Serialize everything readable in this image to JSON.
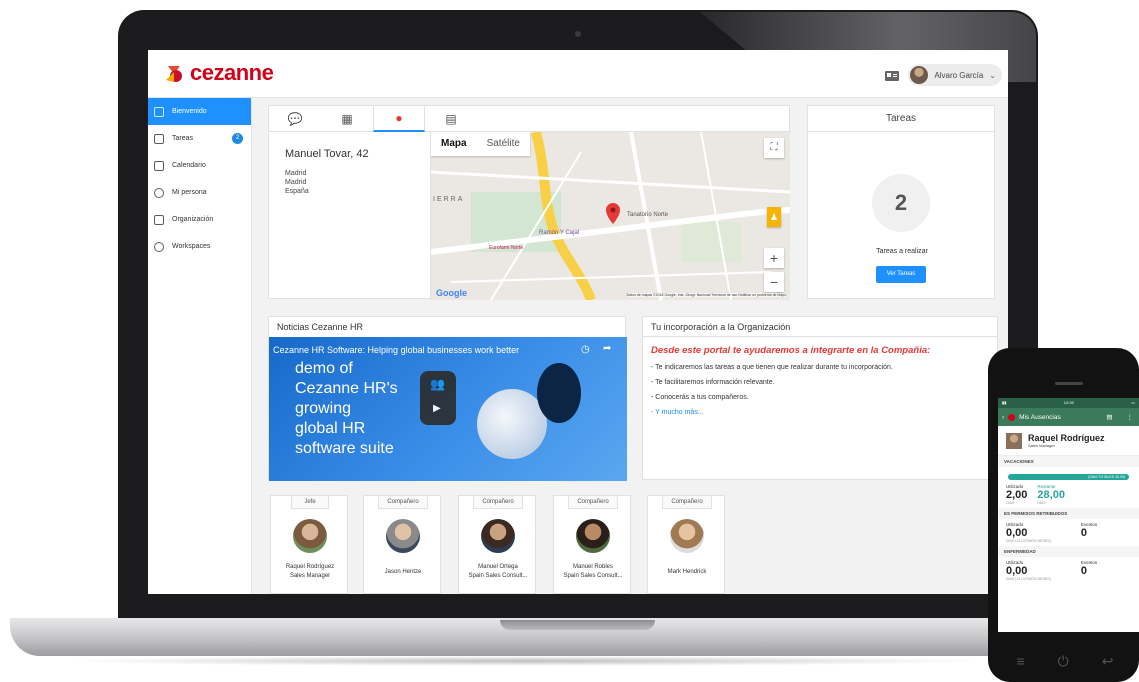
{
  "brand": {
    "logo_text": "cezanne",
    "logo_color": "#d0021b",
    "accent": "#1e90ff"
  },
  "header": {
    "user_name": "Alvaro García",
    "menu_icon": "id-card-icon",
    "dropdown_icon": "chevron-down-icon"
  },
  "sidebar": {
    "items": [
      {
        "label": "Bienvenido",
        "icon": "edit-icon",
        "active": true
      },
      {
        "label": "Tareas",
        "icon": "checkbox-icon",
        "badge": "2"
      },
      {
        "label": "Calendario",
        "icon": "calendar-icon"
      },
      {
        "label": "Mi persona",
        "icon": "person-icon"
      },
      {
        "label": "Organización",
        "icon": "org-chart-icon"
      },
      {
        "label": "Workspaces",
        "icon": "chat-icon"
      }
    ]
  },
  "map_card": {
    "tabs": [
      "chat-icon",
      "calendar-icon",
      "location-pin-icon",
      "id-card-icon"
    ],
    "address_line": "Manuel Tovar, 42",
    "city": "Madrid",
    "region": "Madrid",
    "country": "España",
    "map_type_map": "Mapa",
    "map_type_satellite": "Satélite",
    "map_labels": [
      "IERRA",
      "Tanatorio Norte",
      "Ramón Y Cajal",
      "Eurofarm Norte"
    ],
    "google": "Google",
    "attribution": "Datos de mapas ©2018 Google, Inst. Geogr. Nacional   Términos de uso   Notificar un problema de Maps",
    "zoom_in": "+",
    "zoom_out": "−"
  },
  "tareas": {
    "title": "Tareas",
    "count": "2",
    "label": "Tareas a realizar",
    "button": "Ver Tareas"
  },
  "news": {
    "title": "Noticias Cezanne HR",
    "video_caption": "Cezanne HR Software: Helping global businesses work better",
    "video_lines": [
      "demo of",
      "Cezanne HR's",
      "growing",
      "global HR",
      "software suite"
    ]
  },
  "incorporation": {
    "title": "Tu incorporación a la Organización",
    "lead": "Desde este portal te ayudaremos a integrarte en la Compañia:",
    "items": [
      "- Te indicaremos las tareas a que tienen que realizar durante tu incorporación.",
      "- Te facilitaremos información relevante.",
      "- Conocerás a tus compañeros.",
      "- Y mucho más..."
    ]
  },
  "people": [
    {
      "role": "Jefe",
      "name": "Raquel Rodríguez",
      "title": "Sales Manager"
    },
    {
      "role": "Compañero",
      "name": "Jason Hentze",
      "title": ""
    },
    {
      "role": "Compañero",
      "name": "Manuel Ortega",
      "title": "Spain Sales Consult..."
    },
    {
      "role": "Compañero",
      "name": "Manuel Robles",
      "title": "Spain Sales Consult..."
    },
    {
      "role": "Compañero",
      "name": "Mark Hendrick",
      "title": ""
    }
  ],
  "phone": {
    "time": "12:00",
    "app_title": "Mis Ausencias",
    "name": "Raquel Rodríguez",
    "job": "Sales Manager",
    "vacaciones_title": "VACACIONES",
    "vacaciones_bar": "(DÍAS TOTALES 30,00)",
    "used_label": "Utilizado",
    "remaining_label": "Restante",
    "used_value": "2,00",
    "remaining_value": "28,00",
    "used_sub": "DÍAS",
    "remaining_sub": "DÍAS",
    "permisos_title": "ES PERMISOS RETRIBUIDOS",
    "events_label": "Eventos",
    "permisos_used": "0,00",
    "permisos_events": "0",
    "permisos_sub": "DÍAS (12 ÚLTIMOS MESES)",
    "enfermedad_title": "ENFERMEDAD",
    "enf_used": "0,00",
    "enf_events": "0",
    "enf_sub": "DÍAS (12 ÚLTIMOS MESES)",
    "nav": [
      "≡",
      "⏻",
      "↩"
    ]
  }
}
